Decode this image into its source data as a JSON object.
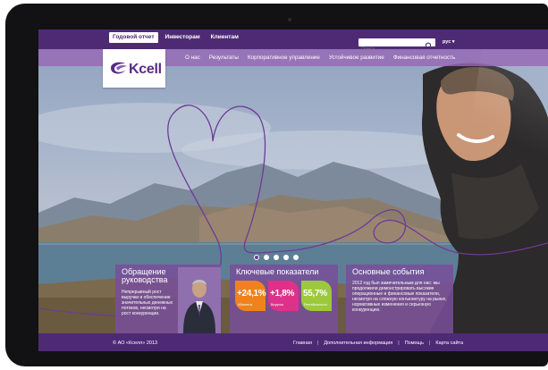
{
  "topbar": {
    "items": [
      {
        "label": "Годовой отчет",
        "active": true
      },
      {
        "label": "Инвесторам",
        "active": false
      },
      {
        "label": "Клиентам",
        "active": false
      }
    ],
    "search_placeholder": "Поиск",
    "language": "рус ▾"
  },
  "logo": {
    "text": "Kcell"
  },
  "main_nav": [
    {
      "label": "О нас"
    },
    {
      "label": "Результаты"
    },
    {
      "label": "Корпоративное управление"
    },
    {
      "label": "Устойчивое развитие"
    },
    {
      "label": "Финансовая отчетность"
    }
  ],
  "carousel": {
    "count": 5,
    "active_index": 0
  },
  "panels": {
    "leadership": {
      "title": "Обращение руководства",
      "text": "Непрерывный рост выручки и обеспечение значительных денежных потоков, несмотря на рост конкуренции."
    },
    "key_indicators": {
      "title": "Ключевые показатели",
      "metrics": [
        {
          "value": "+24,1%",
          "label": "Абоненты",
          "color": "#f0821e"
        },
        {
          "value": "+1,8%",
          "label": "Выручка",
          "color": "#e0318a"
        },
        {
          "value": "55,7%",
          "label": "Рентабельность",
          "color": "#9cc93a"
        }
      ]
    },
    "events": {
      "title": "Основные события",
      "text": "2012 год был замечательным для нас: мы продолжили демонстрировать высокие операционные и финансовые показатели, несмотря на сложную конъюнктуру на рынке, нормативные изменения и серьезную конкуренцию."
    }
  },
  "footer": {
    "copyright": "© АО «Кселл» 2013",
    "links": [
      "Главная",
      "Дополнительная информация",
      "Помощь",
      "Карта сайта"
    ]
  },
  "colors": {
    "brand": "#4f2a74",
    "nav": "#9768b6",
    "panel": "#784e9a"
  }
}
